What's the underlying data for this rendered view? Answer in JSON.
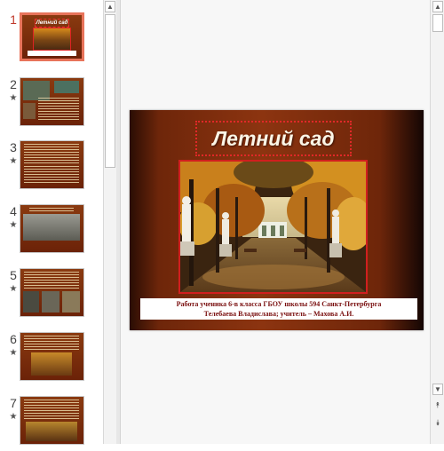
{
  "thumbnails": [
    {
      "number": "1",
      "star": "",
      "active": true
    },
    {
      "number": "2",
      "star": "★",
      "active": false
    },
    {
      "number": "3",
      "star": "★",
      "active": false
    },
    {
      "number": "4",
      "star": "★",
      "active": false
    },
    {
      "number": "5",
      "star": "★",
      "active": false
    },
    {
      "number": "6",
      "star": "★",
      "active": false
    },
    {
      "number": "7",
      "star": "★",
      "active": false
    }
  ],
  "thumb1": {
    "title": "Летний сад"
  },
  "slide": {
    "title": "Летний сад",
    "caption_line1": "Работа ученика 6-в класса ГБОУ школы 594 Санкт-Петербурга",
    "caption_line2": "Телебаева Владислава; учитель – Махова А.И."
  },
  "scrollbars": {
    "up_arrow": "▲",
    "down_arrow": "▼",
    "prev_slide": "⯭",
    "next_slide": "⯯"
  },
  "colors": {
    "accent_active": "#e8735a",
    "slide_bg": "#8c3410",
    "title_border": "#e02828"
  }
}
